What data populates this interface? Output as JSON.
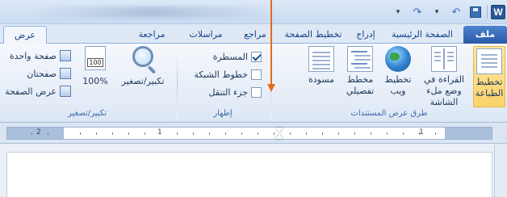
{
  "title_bar": {
    "quick_access": {
      "word_icon_letter": "W",
      "undo_icon": "undo-icon",
      "redo_icon": "redo-icon",
      "save_icon": "save-icon"
    }
  },
  "tabs": {
    "file": "ملف",
    "home": "الصفحة الرئيسية",
    "insert": "إدراج",
    "page_layout": "تخطيط الصفحة",
    "references": "مراجع",
    "mailings": "مراسلات",
    "review": "مراجعة",
    "view": "عرض"
  },
  "ribbon": {
    "document_views": {
      "label": "طرق عرض المستندات",
      "print_layout": "تخطيط الطباعة",
      "full_screen_reading": "القراءة في وضع ملء الشاشة",
      "web_layout": "تخطيط ويب",
      "outline": "مخطط تفصيلي",
      "draft": "مسودة"
    },
    "show": {
      "label": "إظهار",
      "ruler": "المسطرة",
      "ruler_checked": true,
      "gridlines": "خطوط الشبكة",
      "gridlines_checked": false,
      "navigation_pane": "جزء التنقل",
      "navigation_pane_checked": false
    },
    "zoom": {
      "label": "تكبير/تصغير",
      "zoom_button": "تكبير/تصغير",
      "hundred_percent": "100%",
      "hundred_icon_text": "100",
      "one_page": "صفحة واحدة",
      "two_pages": "صفحتان",
      "page_width": "عرض الصفحة"
    }
  },
  "ruler": {
    "labels": [
      "1",
      "1",
      "2"
    ]
  },
  "colors": {
    "accent": "#2b5797",
    "highlight_button": "#fbd26b",
    "callout_arrow": "#e5691b"
  }
}
